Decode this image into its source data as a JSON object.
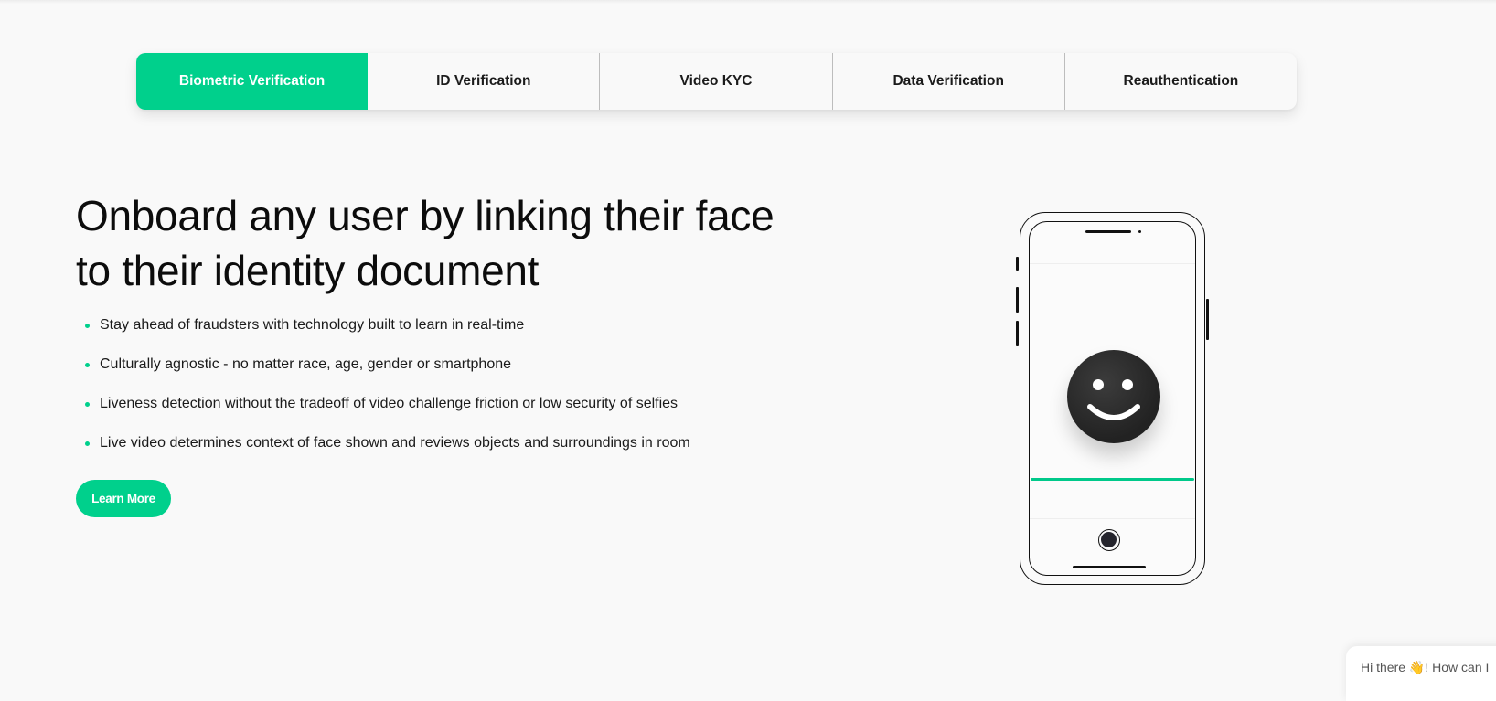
{
  "tabs": [
    {
      "label": "Biometric Verification",
      "active": true
    },
    {
      "label": "ID Verification",
      "active": false
    },
    {
      "label": "Video KYC",
      "active": false
    },
    {
      "label": "Data Verification",
      "active": false
    },
    {
      "label": "Reauthentication",
      "active": false
    }
  ],
  "hero": {
    "headline_line1": "Onboard any user by linking their face",
    "headline_line2": "to their identity document",
    "bullets": [
      "Stay ahead of fraudsters with technology built to learn in real-time",
      "Culturally agnostic - no matter race, age, gender or smartphone",
      "Liveness detection without the tradeoff of video challenge friction or low security of selfies",
      "Live video determines context of face shown and reviews objects and surroundings in room"
    ],
    "cta_label": "Learn More"
  },
  "illustration": {
    "device": "phone-icon",
    "face_icon": "smiley-face-icon"
  },
  "chat": {
    "greeting_prefix": "Hi there ",
    "wave_icon": "👋",
    "greeting_suffix": "! How can I"
  },
  "colors": {
    "accent": "#00d08c",
    "background": "#f9f9f9",
    "text": "#111111"
  }
}
